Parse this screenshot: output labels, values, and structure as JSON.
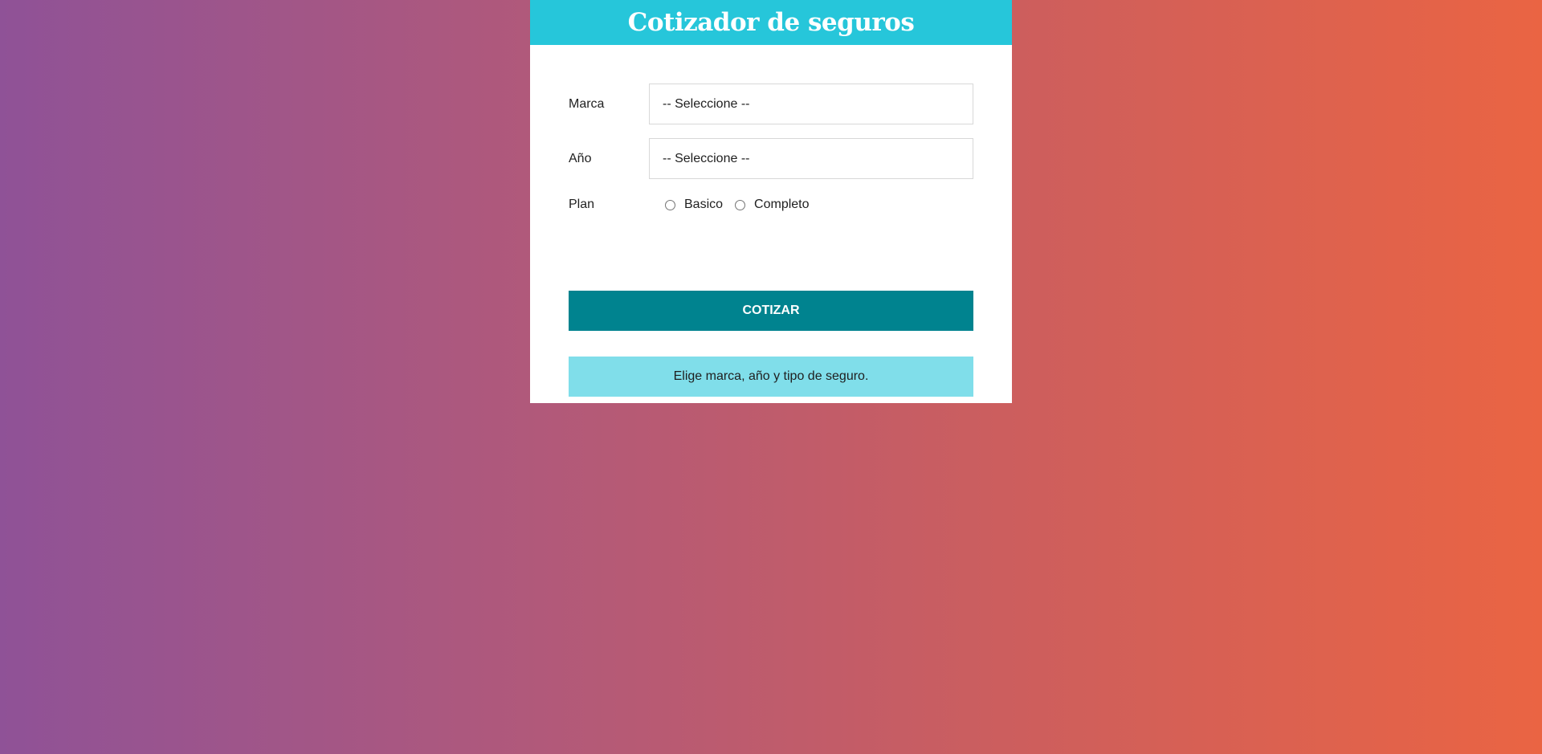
{
  "header": {
    "title": "Cotizador de seguros"
  },
  "form": {
    "marca": {
      "label": "Marca",
      "selected": "-- Seleccione --"
    },
    "anio": {
      "label": "Año",
      "selected": "-- Seleccione --"
    },
    "plan": {
      "label": "Plan",
      "options": [
        {
          "label": "Basico",
          "checked": false
        },
        {
          "label": "Completo",
          "checked": false
        }
      ]
    },
    "submit_label": "COTIZAR"
  },
  "message": {
    "text": "Elige marca, año y tipo de seguro."
  },
  "colors": {
    "header_bg": "#26c6da",
    "button_bg": "#00838f",
    "message_bg": "#80deea",
    "gradient_start": "#8f5297",
    "gradient_end": "#ea6443"
  }
}
